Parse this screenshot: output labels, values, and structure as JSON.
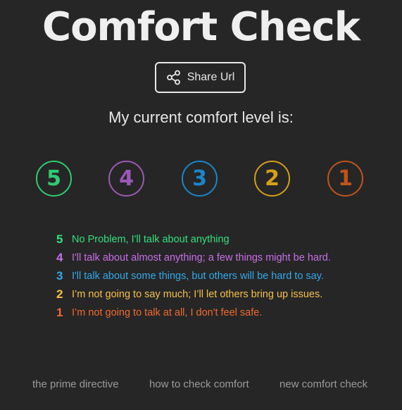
{
  "header": {
    "title": "Comfort Check",
    "share_label": "Share Url"
  },
  "prompt": "My current comfort level is:",
  "levels": [
    {
      "num": "5",
      "color": "#2ecc71"
    },
    {
      "num": "4",
      "color": "#9b59b6"
    },
    {
      "num": "3",
      "color": "#1a86c8"
    },
    {
      "num": "2",
      "color": "#d4a017"
    },
    {
      "num": "1",
      "color": "#c0541a"
    }
  ],
  "legend": [
    {
      "num": "5",
      "text": "No Problem, I'll talk about anything",
      "color": "#33e07f"
    },
    {
      "num": "4",
      "text": "I'll talk about almost anything; a few things might be hard.",
      "color": "#c86fe8"
    },
    {
      "num": "3",
      "text": "I'll talk about some things, but others will be hard to say.",
      "color": "#33a9ea"
    },
    {
      "num": "2",
      "text": "I’m not going to say much; I’ll let others bring up issues.",
      "color": "#f5c04a"
    },
    {
      "num": "1",
      "text": "I’m not going to talk at all, I don't feel safe.",
      "color": "#f06a2e"
    }
  ],
  "footer": {
    "links": [
      "the prime directive",
      "how to check comfort",
      "new comfort check"
    ]
  }
}
